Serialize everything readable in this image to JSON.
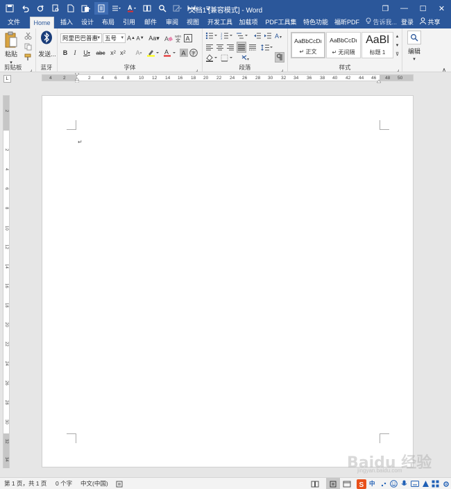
{
  "window": {
    "title": "文档1 [兼容模式] - Word",
    "controls": {
      "restore": "❐",
      "minimize": "—",
      "maximize": "☐",
      "close": "✕"
    }
  },
  "qat": [
    {
      "name": "save-icon",
      "glyph": "💾"
    },
    {
      "name": "undo-icon",
      "glyph": "↶"
    },
    {
      "name": "redo-icon",
      "glyph": "↻"
    },
    {
      "name": "print-preview-icon",
      "glyph": "🔍"
    },
    {
      "name": "new-doc-icon",
      "glyph": "🗋"
    },
    {
      "name": "paste-options-icon",
      "glyph": "📋"
    },
    {
      "name": "layout-icon",
      "glyph": "▤"
    },
    {
      "name": "format-icon",
      "glyph": "≡"
    },
    {
      "name": "font-color-icon",
      "glyph": "A"
    },
    {
      "name": "read-mode-icon",
      "glyph": "▯▯"
    },
    {
      "name": "find-icon",
      "glyph": "🔎"
    },
    {
      "name": "edit-icon",
      "glyph": "✎"
    },
    {
      "name": "width-icon",
      "glyph": "⟷"
    },
    {
      "name": "customize-icon",
      "glyph": "▾"
    }
  ],
  "tabs": [
    "文件",
    "Home",
    "插入",
    "设计",
    "布局",
    "引用",
    "邮件",
    "审阅",
    "视图",
    "开发工具",
    "加载项",
    "PDF工具集",
    "特色功能",
    "福昕PDF"
  ],
  "tellme": "告诉我...",
  "signin": "登录",
  "share": "共享",
  "ribbon": {
    "clipboard": {
      "label": "剪贴板",
      "paste": "粘贴"
    },
    "bluetooth": {
      "label": "蓝牙",
      "send": "发送..."
    },
    "font": {
      "label": "字体",
      "face": "阿里巴巴普惠",
      "size": "五号"
    },
    "paragraph": {
      "label": "段落"
    },
    "styles": {
      "label": "样式",
      "items": [
        {
          "sample": "AaBbCcDı",
          "name": "↵ 正文"
        },
        {
          "sample": "AaBbCcDı",
          "name": "↵ 无间隔"
        },
        {
          "sample": "AaBl",
          "name": "标题 1"
        }
      ]
    },
    "editing": {
      "label": "编辑"
    }
  },
  "ruler": {
    "corner": "L",
    "h_ticks": [
      "4",
      "2",
      "",
      "2",
      "4",
      "6",
      "8",
      "10",
      "12",
      "14",
      "16",
      "18",
      "20",
      "22",
      "24",
      "26",
      "28",
      "30",
      "32",
      "34",
      "36",
      "38",
      "40",
      "42",
      "44",
      "46",
      "",
      "48",
      "50"
    ],
    "v_ticks": [
      "2",
      "",
      "2",
      "4",
      "6",
      "8",
      "10",
      "12",
      "14",
      "16",
      "18",
      "20",
      "22",
      "24",
      "26",
      "28",
      "30",
      "32",
      "34"
    ]
  },
  "document": {
    "paragraph_mark": "↵"
  },
  "status": {
    "page": "第 1 页，共 1 页",
    "words": "0 个字",
    "language": "中文(中国)"
  },
  "watermark": {
    "brand": "Baidu 经验",
    "url": "jingyan.baidu.com"
  }
}
